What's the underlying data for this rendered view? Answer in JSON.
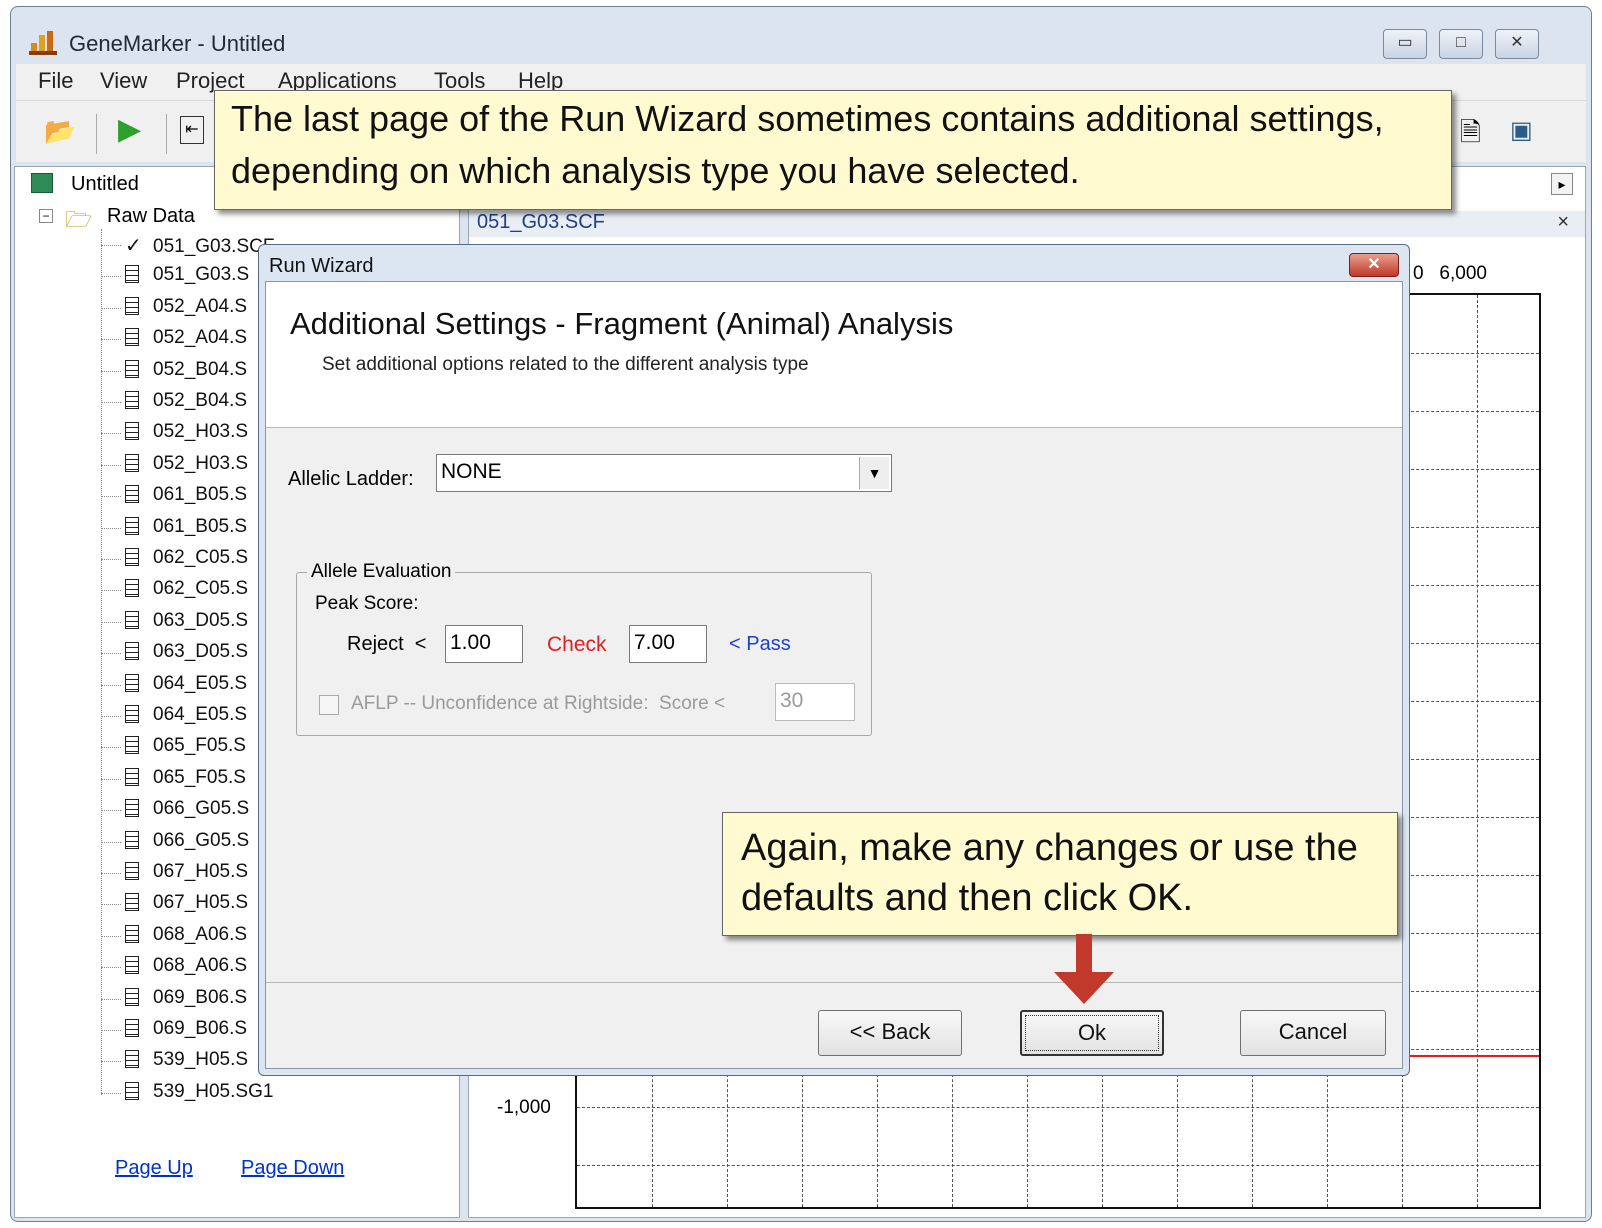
{
  "window": {
    "title": "GeneMarker - Untitled",
    "icon": "genemarker-app-icon"
  },
  "menu": [
    "File",
    "View",
    "Project",
    "Applications",
    "Tools",
    "Help"
  ],
  "tree": {
    "root": "Untitled",
    "folder": "Raw Data",
    "items": [
      "051_G03.SCF",
      "051_G03.S",
      "052_A04.S",
      "052_A04.S",
      "052_B04.S",
      "052_B04.S",
      "052_H03.S",
      "052_H03.S",
      "061_B05.S",
      "061_B05.S",
      "062_C05.S",
      "062_C05.S",
      "063_D05.S",
      "063_D05.S",
      "064_E05.S",
      "064_E05.S",
      "065_F05.S",
      "065_F05.S",
      "066_G05.S",
      "066_G05.S",
      "067_H05.S",
      "067_H05.S",
      "068_A06.S",
      "068_A06.S",
      "069_B06.S",
      "069_B06.S",
      "539_H05.S",
      "539_H05.SG1"
    ]
  },
  "left_footer": {
    "page_up": "Page Up",
    "page_down": "Page Down"
  },
  "right_panel": {
    "tab_title": "051_G03.SCF",
    "axis_top_right": "0   6,000",
    "axis_bottom_left": "-1,000",
    "trace_color": "#e02020"
  },
  "callouts": {
    "top": "The last page of the Run Wizard sometimes contains additional settings, depending on which analysis type you  have selected.",
    "bottom": "Again, make any changes or use the defaults and then click OK."
  },
  "dialog": {
    "title": "Run Wizard",
    "heading": "Additional Settings - Fragment (Animal) Analysis",
    "subheading": "Set additional options related to the different analysis type",
    "allelic_ladder_label": "Allelic Ladder:",
    "allelic_ladder_value": "NONE",
    "group_title": "Allele Evaluation",
    "peak_score_label": "Peak Score:",
    "reject_label": "Reject  <",
    "reject_value": "1.00",
    "check_label": "Check",
    "check_value": "7.00",
    "pass_label": "< Pass",
    "aflp_label": "AFLP -- Unconfidence at Rightside:  Score <",
    "aflp_value": "30",
    "back_button": "<< Back",
    "ok_button": "Ok",
    "cancel_button": "Cancel",
    "colors": {
      "check": "#e02020",
      "pass": "#1a3fd6",
      "arrow": "#c0392b"
    }
  }
}
